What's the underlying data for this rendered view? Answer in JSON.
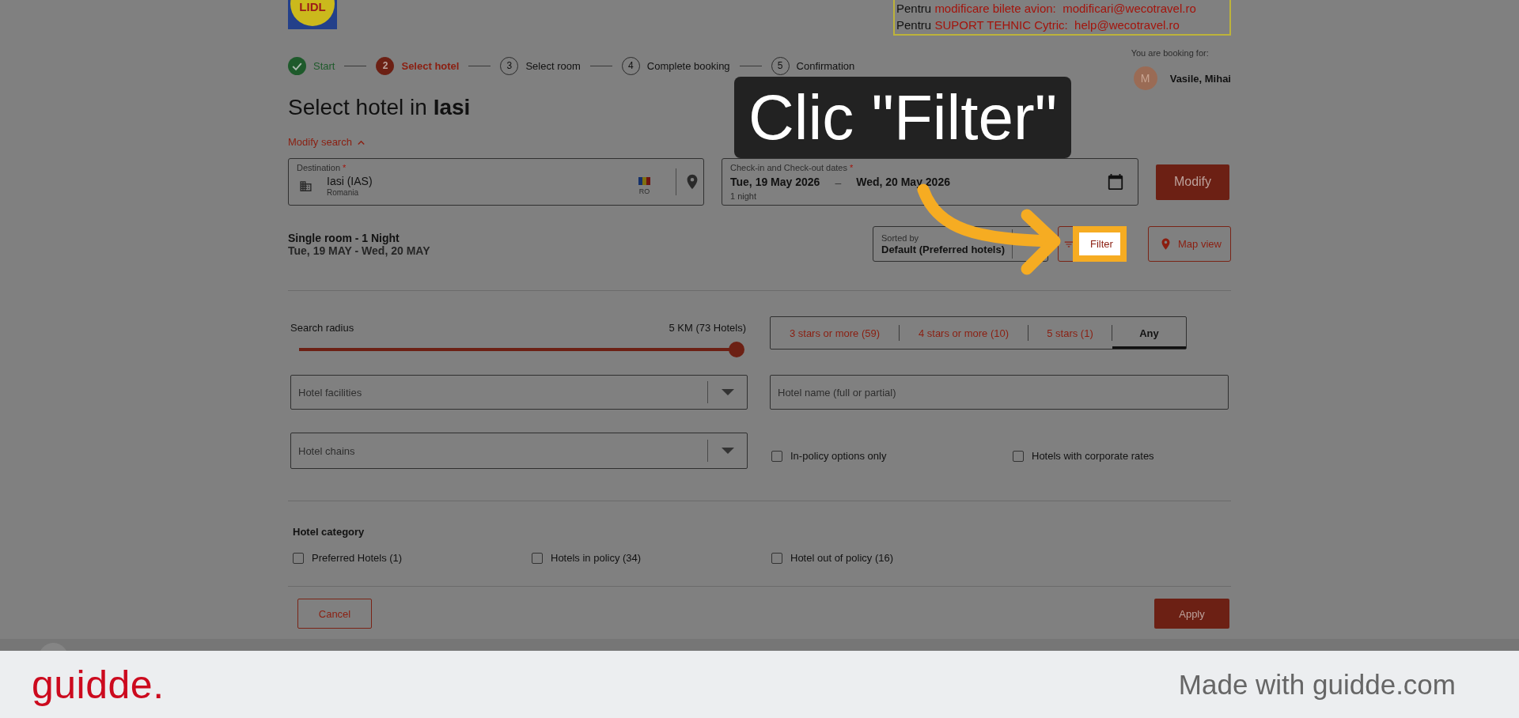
{
  "header": {
    "logo_text": "LIDL",
    "contact_lines": [
      {
        "lead": "Pentru",
        "topic": "modificare bilete avion:",
        "email": "modificari@wecotravel.ro"
      },
      {
        "lead": "Pentru",
        "topic": "SUPORT TEHNIC Cytric:",
        "email": "help@wecotravel.ro"
      }
    ]
  },
  "steps": [
    {
      "kind": "done",
      "label": "Start"
    },
    {
      "kind": "current",
      "number": "2",
      "label": "Select hotel"
    },
    {
      "kind": "upcoming",
      "number": "3",
      "label": "Select room"
    },
    {
      "kind": "upcoming",
      "number": "4",
      "label": "Complete booking"
    },
    {
      "kind": "upcoming",
      "number": "5",
      "label": "Confirmation"
    }
  ],
  "booking_for": {
    "label": "You are booking for:",
    "initial": "M",
    "name": "Vasile, Mihai"
  },
  "title": "Select hotel in **Iasi**",
  "modify_search": {
    "label": "Modify search",
    "expanded": true
  },
  "destination": {
    "label": "Destination",
    "required_mark": "*",
    "value": "Iasi (IAS)",
    "country": "Romania",
    "country_code": "RO"
  },
  "dates": {
    "label": "Check-in and Check-out dates",
    "required_mark": "*",
    "check_in": "Tue, 19 May 2026",
    "separator": "–",
    "check_out": "Wed, 20 May 2026",
    "nights": "1 night"
  },
  "modify_button": "Modify",
  "summary": {
    "room": "Single room - 1 Night",
    "dates": "Tue, 19 MAY - Wed, 20 MAY"
  },
  "sort": {
    "label": "Sorted by",
    "value": "Default (Preferred hotels)"
  },
  "filter_button": {
    "label": "Filter",
    "highlighted": true
  },
  "map_view_button": "Map view",
  "filters": {
    "search_radius": {
      "label": "Search radius",
      "reading": "5 KM (73 Hotels)",
      "level": 1
    },
    "star_tabs": [
      {
        "label": "3 stars or more (59)",
        "selected": false
      },
      {
        "label": "4 stars or more (10)",
        "selected": false
      },
      {
        "label": "5 stars (1)",
        "selected": false
      },
      {
        "label": "Any",
        "selected": true
      }
    ],
    "hotel_facilities": {
      "placeholder": "Hotel facilities"
    },
    "hotel_name": {
      "placeholder": "Hotel name (full or partial)"
    },
    "hotel_chains": {
      "placeholder": "Hotel chains"
    },
    "options": [
      {
        "label": "In-policy options only",
        "checked": false
      },
      {
        "label": "Hotels with corporate rates",
        "checked": false
      }
    ],
    "hotel_category": {
      "title": "Hotel category",
      "options": [
        {
          "label": "Preferred Hotels (1)",
          "checked": false
        },
        {
          "label": "Hotels in policy (34)",
          "checked": false
        },
        {
          "label": "Hotel out of policy (16)",
          "checked": false
        }
      ]
    },
    "cancel_button": "Cancel",
    "apply_button": "Apply"
  },
  "annotation": {
    "text": "Clic \"Filter\""
  },
  "footer": {
    "logo": "guidde.",
    "credit": "Made with guidde.com"
  }
}
